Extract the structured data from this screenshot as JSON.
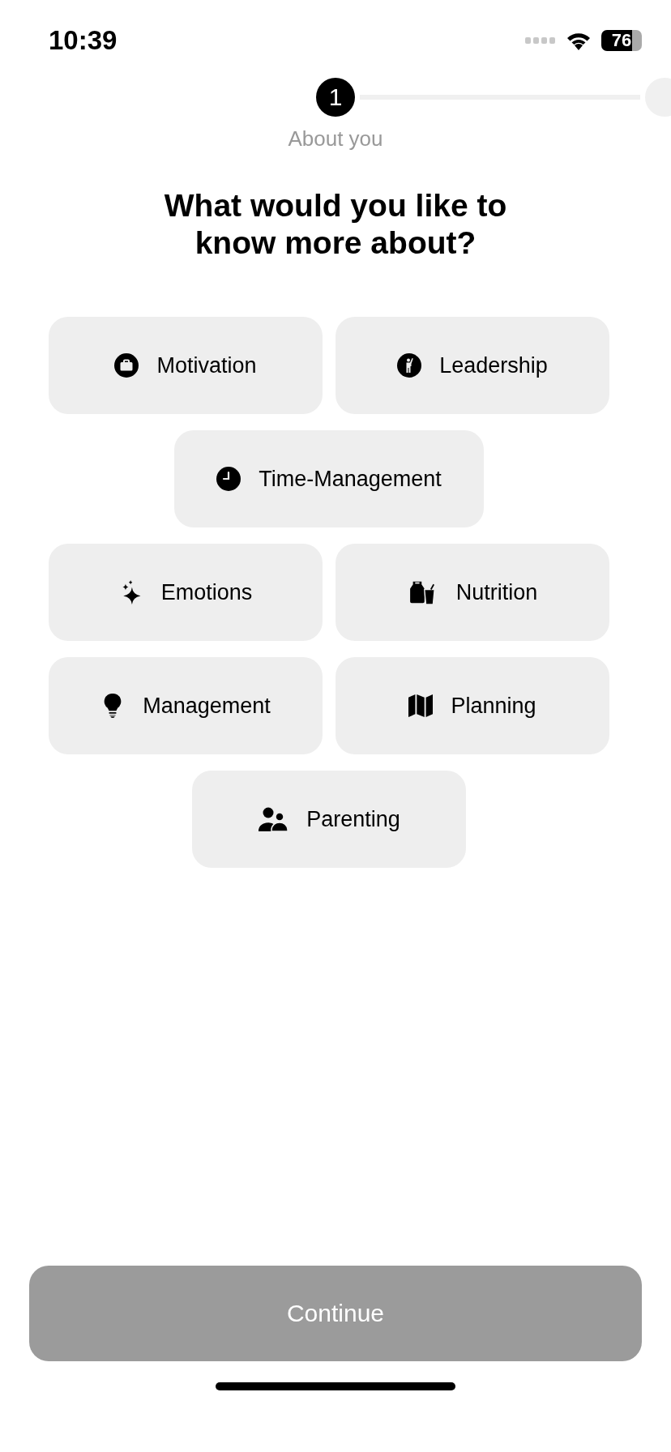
{
  "status_bar": {
    "time": "10:39",
    "battery": "76"
  },
  "stepper": {
    "steps": [
      {
        "label": "1",
        "caption": "About you",
        "selected": true
      },
      {
        "selected": false
      }
    ]
  },
  "title": "What would you like to know more about?",
  "topics": [
    {
      "label": "Motivation",
      "kind": "bag",
      "selected": false
    },
    {
      "label": "Leadership",
      "kind": "person",
      "selected": false
    },
    {
      "label": "Time-Management",
      "kind": "clock",
      "selected": false
    },
    {
      "label": "Emotions",
      "kind": "sparkles",
      "selected": false
    },
    {
      "label": "Nutrition",
      "kind": "food",
      "selected": false
    },
    {
      "label": "Management",
      "kind": "bulb",
      "selected": false
    },
    {
      "label": "Planning",
      "kind": "map",
      "selected": false
    },
    {
      "label": "Parenting",
      "kind": "people",
      "selected": false
    }
  ],
  "continue_button": {
    "label": "Continue",
    "disabled": true
  }
}
